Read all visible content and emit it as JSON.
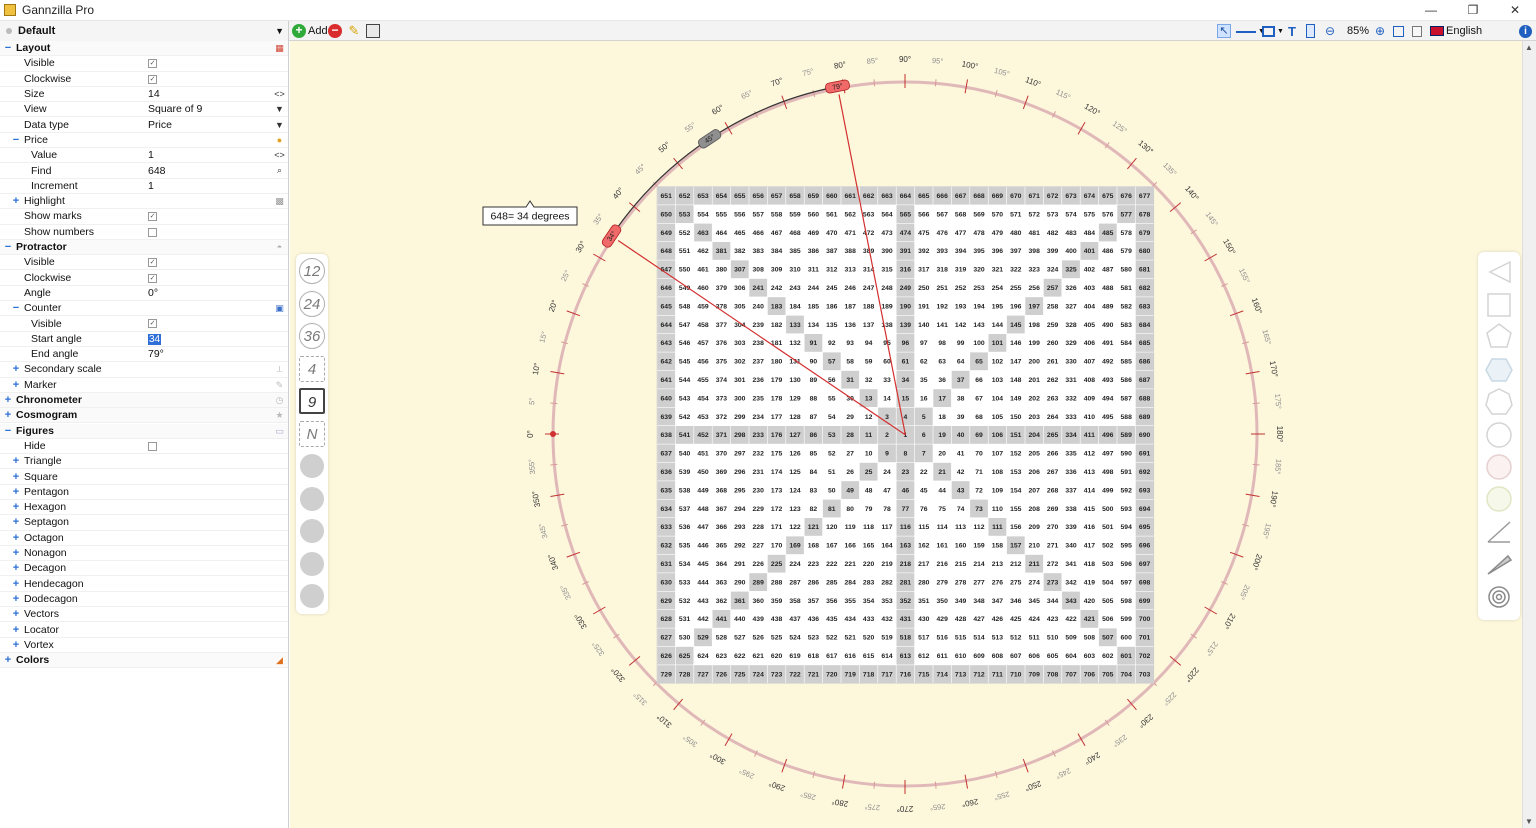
{
  "window": {
    "title": "Gannzilla Pro",
    "min": "—",
    "max": "❐",
    "close": "✕"
  },
  "toolbar": {
    "preset": "Default",
    "add_label": "Add",
    "zoom": "85%",
    "language": "English"
  },
  "panel": {
    "rows": [
      {
        "type": "section",
        "exp": "−",
        "name": "Layout",
        "indent": 0,
        "icon": "grid"
      },
      {
        "type": "check",
        "name": "Visible",
        "indent": 2,
        "checked": true
      },
      {
        "type": "check",
        "name": "Clockwise",
        "indent": 2,
        "checked": true
      },
      {
        "type": "value",
        "name": "Size",
        "indent": 2,
        "value": "14",
        "icon": "<>"
      },
      {
        "type": "value",
        "name": "View",
        "indent": 2,
        "value": "Square of 9",
        "icon": "▼"
      },
      {
        "type": "value",
        "name": "Data type",
        "indent": 2,
        "value": "Price",
        "icon": "▼"
      },
      {
        "type": "group",
        "exp": "−",
        "name": "Price",
        "indent": 1,
        "icon": "coin"
      },
      {
        "type": "value",
        "name": "Value",
        "indent": 3,
        "value": "1",
        "icon": "<>"
      },
      {
        "type": "value",
        "name": "Find",
        "indent": 3,
        "value": "648",
        "icon": "search"
      },
      {
        "type": "value",
        "name": "Increment",
        "indent": 3,
        "value": "1"
      },
      {
        "type": "group",
        "exp": "+",
        "name": "Highlight",
        "indent": 1,
        "icon": "pattern"
      },
      {
        "type": "check",
        "name": "Show marks",
        "indent": 2,
        "checked": true
      },
      {
        "type": "check",
        "name": "Show numbers",
        "indent": 2,
        "checked": false
      },
      {
        "type": "section",
        "exp": "−",
        "name": "Protractor",
        "indent": 0,
        "icon": "protractor"
      },
      {
        "type": "check",
        "name": "Visible",
        "indent": 2,
        "checked": true
      },
      {
        "type": "check",
        "name": "Clockwise",
        "indent": 2,
        "checked": true
      },
      {
        "type": "value",
        "name": "Angle",
        "indent": 2,
        "value": "0°"
      },
      {
        "type": "group",
        "exp": "−",
        "name": "Counter",
        "indent": 1,
        "icon": "counter"
      },
      {
        "type": "check",
        "name": "Visible",
        "indent": 3,
        "checked": true
      },
      {
        "type": "selected",
        "name": "Start angle",
        "indent": 3,
        "value": "34"
      },
      {
        "type": "value",
        "name": "End angle",
        "indent": 3,
        "value": "79°"
      },
      {
        "type": "group",
        "exp": "+",
        "name": "Secondary scale",
        "indent": 1,
        "icon": "scale"
      },
      {
        "type": "group",
        "exp": "+",
        "name": "Marker",
        "indent": 1,
        "icon": "marker"
      },
      {
        "type": "section",
        "exp": "+",
        "name": "Chronometer",
        "indent": 0,
        "icon": "clock"
      },
      {
        "type": "section",
        "exp": "+",
        "name": "Cosmogram",
        "indent": 0,
        "icon": "star"
      },
      {
        "type": "section",
        "exp": "−",
        "name": "Figures",
        "indent": 0,
        "icon": "figure"
      },
      {
        "type": "check",
        "name": "Hide",
        "indent": 2,
        "checked": false
      },
      {
        "type": "group",
        "exp": "+",
        "name": "Triangle",
        "indent": 1
      },
      {
        "type": "group",
        "exp": "+",
        "name": "Square",
        "indent": 1
      },
      {
        "type": "group",
        "exp": "+",
        "name": "Pentagon",
        "indent": 1
      },
      {
        "type": "group",
        "exp": "+",
        "name": "Hexagon",
        "indent": 1
      },
      {
        "type": "group",
        "exp": "+",
        "name": "Septagon",
        "indent": 1
      },
      {
        "type": "group",
        "exp": "+",
        "name": "Octagon",
        "indent": 1
      },
      {
        "type": "group",
        "exp": "+",
        "name": "Nonagon",
        "indent": 1
      },
      {
        "type": "group",
        "exp": "+",
        "name": "Decagon",
        "indent": 1
      },
      {
        "type": "group",
        "exp": "+",
        "name": "Hendecagon",
        "indent": 1
      },
      {
        "type": "group",
        "exp": "+",
        "name": "Dodecagon",
        "indent": 1
      },
      {
        "type": "group",
        "exp": "+",
        "name": "Vectors",
        "indent": 1
      },
      {
        "type": "group",
        "exp": "+",
        "name": "Locator",
        "indent": 1
      },
      {
        "type": "group",
        "exp": "+",
        "name": "Vortex",
        "indent": 1
      },
      {
        "type": "section",
        "exp": "+",
        "name": "Colors",
        "indent": 0,
        "icon": "colors"
      }
    ]
  },
  "left_tools": [
    "12",
    "24",
    "36",
    "4",
    "9",
    "N"
  ],
  "protractor": {
    "ticks": [
      "0°",
      "5°",
      "10°",
      "15°",
      "20°",
      "25°",
      "30°",
      "35°",
      "40°",
      "45°",
      "50°",
      "55°",
      "60°",
      "65°",
      "70°",
      "75°",
      "80°",
      "85°",
      "90°",
      "95°",
      "100°",
      "105°",
      "110°",
      "115°",
      "120°",
      "125°",
      "130°",
      "135°",
      "140°",
      "145°",
      "150°",
      "155°",
      "160°",
      "165°",
      "170°",
      "175°",
      "180°",
      "185°",
      "190°",
      "195°",
      "200°",
      "205°",
      "210°",
      "215°",
      "220°",
      "225°",
      "230°",
      "235°",
      "240°",
      "245°",
      "250°",
      "255°",
      "260°",
      "265°",
      "270°",
      "275°",
      "280°",
      "285°",
      "290°",
      "295°",
      "300°",
      "305°",
      "310°",
      "315°",
      "320°",
      "325°",
      "330°",
      "335°",
      "340°",
      "345°",
      "350°",
      "355°"
    ],
    "counter_start_label": "34°",
    "counter_end_label": "79°",
    "counter_mid_label": "45°",
    "callout": "648= 34 degrees",
    "start_angle": 34,
    "end_angle": 79
  },
  "grid": {
    "size": 27,
    "highlight_color": "#cfcfcf",
    "rows": [
      "651 652 653 654 655 656 657 658 659 660 661 662 663 664 665 666 667 668 669 670 671 672 673 674 675 676 677",
      "650 553 554 555 556 557 558 559 560 561 562 563 564 565 566 567 568 569 570 571 572 573 574 575 576 577 678",
      "649 552 463 464 465 466 467 468 469 470 471 472 473 474 475 476 477 478 479 480 481 482 483 484 485 578 679",
      "648 551 462 381 382 383 384 385 386 387 388 389 390 391 392 393 394 395 396 397 398 399 400 401 486 579 680",
      "647 550 461 380 307 308 309 310 311 312 313 314 315 316 317 318 319 320 321 322 323 324 325 402 487 580 681",
      "646 549 460 379 306 241 242 243 244 245 246 247 248 249 250 251 252 253 254 255 256 257 326 403 488 581 682",
      "645 548 459 378 305 240 183 184 185 186 187 188 189 190 191 192 193 194 195 196 197 258 327 404 489 582 683",
      "644 547 458 377 304 239 182 133 134 135 136 137 138 139 140 141 142 143 144 145 198 259 328 405 490 583 684",
      "643 546 457 376 303 238 181 132 91 92 93 94 95 96 97 98 99 100 101 146 199 260 329 406 491 584 685",
      "642 545 456 375 302 237 180 131 90 57 58 59 60 61 62 63 64 65 102 147 200 261 330 407 492 585 686",
      "641 544 455 374 301 236 179 130 89 56 31 32 33 34 35 36 37 66 103 148 201 262 331 408 493 586 687",
      "640 543 454 373 300 235 178 129 88 55 30 13 14 15 16 17 38 67 104 149 202 263 332 409 494 587 688",
      "639 542 453 372 299 234 177 128 87 54 29 12 3 4 5 18 39 68 105 150 203 264 333 410 495 588 689",
      "638 541 452 371 298 233 176 127 86 53 28 11 2 1 6 19 40 69 106 151 204 265 334 411 496 589 690",
      "637 540 451 370 297 232 175 126 85 52 27 10 9 8 7 20 41 70 107 152 205 266 335 412 497 590 691",
      "636 539 450 369 296 231 174 125 84 51 26 25 24 23 22 21 42 71 108 153 206 267 336 413 498 591 692",
      "635 538 449 368 295 230 173 124 83 50 49 48 47 46 45 44 43 72 109 154 207 268 337 414 499 592 693",
      "634 537 448 367 294 229 172 123 82 81 80 79 78 77 76 75 74 73 110 155 208 269 338 415 500 593 694",
      "633 536 447 366 293 228 171 122 121 120 119 118 117 116 115 114 113 112 111 156 209 270 339 416 501 594 695",
      "632 535 446 365 292 227 170 169 168 167 166 165 164 163 162 161 160 159 158 157 210 271 340 417 502 595 696",
      "631 534 445 364 291 226 225 224 223 222 221 220 219 218 217 216 215 214 213 212 211 272 341 418 503 596 697",
      "630 533 444 363 290 289 288 287 286 285 284 283 282 281 280 279 278 277 276 275 274 273 342 419 504 597 698",
      "629 532 443 362 361 360 359 358 357 356 355 354 353 352 351 350 349 348 347 346 345 344 343 420 505 598 699",
      "628 531 442 441 440 439 438 437 436 435 434 433 432 431 430 429 428 427 426 425 424 423 422 421 506 599 700",
      "627 530 529 528 527 526 525 524 523 522 521 520 519 518 517 516 515 514 513 512 511 510 509 508 507 600 701",
      "626 625 624 623 622 621 620 619 618 617 616 615 614 613 612 611 610 609 608 607 606 605 604 603 602 601 702",
      "729 728 727 726 725 724 723 722 721 720 719 718 717 716 715 714 713 712 711 710 709 708 707 706 705 704 703"
    ]
  }
}
